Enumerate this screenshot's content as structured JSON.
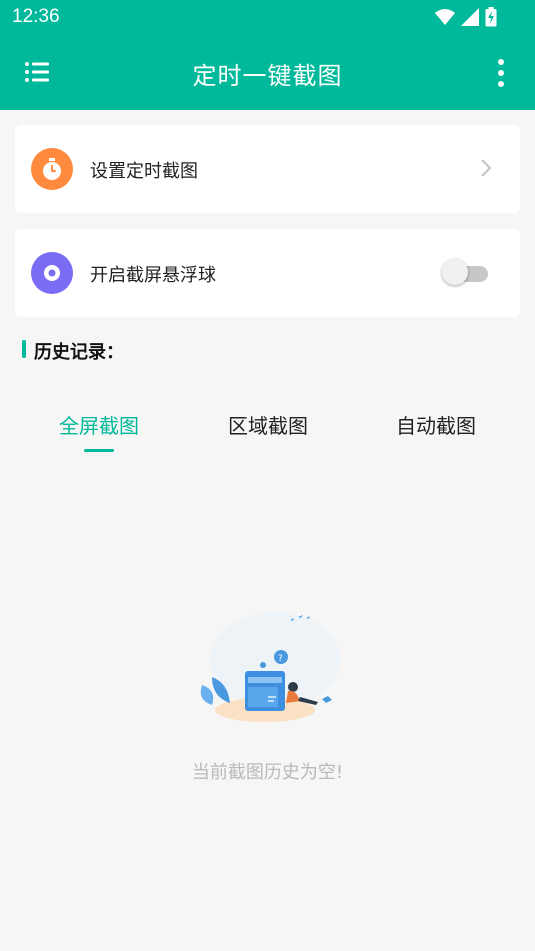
{
  "status_bar": {
    "time": "12:36",
    "icons": [
      "wifi-icon",
      "signal-icon",
      "battery-charging-icon"
    ]
  },
  "app_bar": {
    "title": "定时一键截图",
    "menu_icon": "list-menu-icon",
    "more_icon": "more-vert-icon"
  },
  "cards": [
    {
      "label": "设置定时截图",
      "icon": "timer-icon",
      "icon_color": "#ff8a3d",
      "trailing": "chevron-right-icon"
    },
    {
      "label": "开启截屏悬浮球",
      "icon": "floating-ball-icon",
      "icon_color": "#7b6cf6",
      "trailing": "toggle",
      "toggle_on": false
    }
  ],
  "history": {
    "title": "历史记录："
  },
  "tabs": [
    {
      "label": "全屏截图",
      "active": true
    },
    {
      "label": "区域截图",
      "active": false
    },
    {
      "label": "自动截图",
      "active": false
    }
  ],
  "empty_state": {
    "message": "当前截图历史为空!"
  },
  "colors": {
    "primary": "#00b99a",
    "background": "#f6f6f6",
    "muted_text": "#b9b9b9"
  }
}
